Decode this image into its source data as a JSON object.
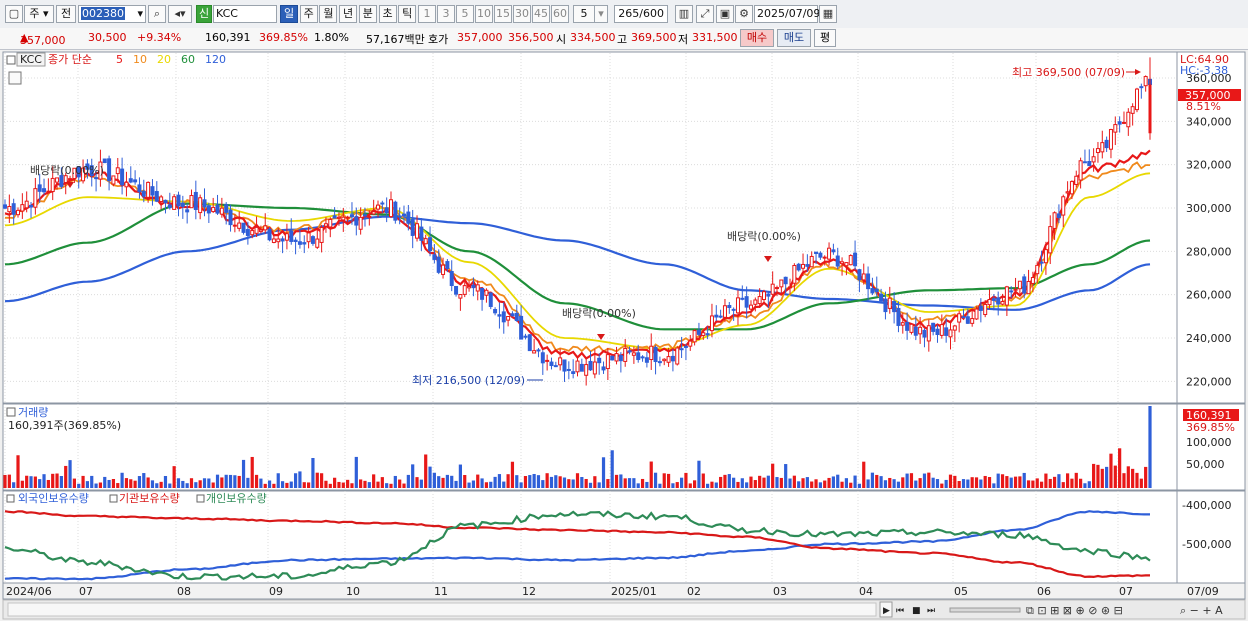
{
  "toolbar": {
    "market_label": "주",
    "prev_label": "전",
    "code": "002380",
    "new_badge": "신",
    "name": "KCC",
    "periods": [
      "일",
      "주",
      "월",
      "년",
      "분",
      "초",
      "틱"
    ],
    "minutes": [
      "1",
      "3",
      "5",
      "10",
      "15",
      "30",
      "45",
      "60"
    ],
    "tick_select": "5",
    "count": "265",
    "count_total": "/600",
    "date": "2025/07/09"
  },
  "quote": {
    "price": "357,000",
    "change": "30,500",
    "change_pct": "+9.34%",
    "volume": "160,391",
    "vol_pct": "369.85%",
    "turnover_pct": "1.80%",
    "amount": "57,167백만",
    "ask_label": "호가",
    "ask": "357,000",
    "bid": "356,500",
    "open_label": "시",
    "open": "334,500",
    "high_label": "고",
    "high": "369,500",
    "low_label": "저",
    "low": "331,500",
    "buy_label": "매수",
    "sell_label": "매도",
    "eval_label": "평"
  },
  "legend": {
    "symbol": "KCC",
    "ma_title": "종가 단순",
    "ma": [
      {
        "period": "5",
        "color": "#e81818"
      },
      {
        "period": "10",
        "color": "#f08a1c"
      },
      {
        "period": "20",
        "color": "#e8d800"
      },
      {
        "period": "60",
        "color": "#1f8f3a"
      },
      {
        "period": "120",
        "color": "#2f5fd8"
      }
    ]
  },
  "price_panel": {
    "lc": "LC:64.90",
    "hc": "HC:-3.38",
    "last_price": "357,000",
    "last_pct": "8.51%",
    "y_ticks": [
      "360,000",
      "340,000",
      "320,000",
      "300,000",
      "280,000",
      "260,000",
      "240,000",
      "220,000"
    ],
    "max_label": "최고 369,500 (07/09)",
    "min_label": "최저 216,500 (12/09)",
    "dividend_labels": [
      "배당락(0.00%)",
      "배당락(0.00%)",
      "배당락(0.00%)"
    ]
  },
  "volume_panel": {
    "title": "거래량",
    "value_label": "160,391주(369.85%)",
    "last": "160,391",
    "last_pct": "369.85%",
    "y_ticks": [
      "100,000",
      "50,000"
    ]
  },
  "holdings_panel": {
    "legend": [
      "외국인보유수량",
      "기관보유수량",
      "개인보유수량"
    ],
    "y_ticks": [
      "-400,000",
      "-500,000"
    ]
  },
  "x_axis": [
    "2024/06",
    "07",
    "08",
    "09",
    "10",
    "11",
    "12",
    "2025/01",
    "02",
    "03",
    "04",
    "05",
    "06",
    "07",
    "07/09"
  ],
  "colors": {
    "up": "#e81818",
    "down": "#2f5fd8",
    "foreign": "#2f5fd8",
    "institution": "#d81818",
    "individual": "#2e8b57"
  },
  "chart_data": {
    "type": "candlestick",
    "title": "KCC",
    "x": [
      "2024/06",
      "07",
      "08",
      "09",
      "10",
      "11",
      "12",
      "2025/01",
      "02",
      "03",
      "04",
      "05",
      "06",
      "07"
    ],
    "series": [
      {
        "name": "종가",
        "values": [
          300000,
          318000,
          302000,
          285000,
          300000,
          262000,
          228000,
          233000,
          255000,
          278000,
          242000,
          262000,
          322000,
          357000
        ]
      },
      {
        "name": "5",
        "values": [
          298000,
          316000,
          300000,
          288000,
          298000,
          265000,
          232000,
          234000,
          252000,
          276000,
          245000,
          260000,
          318000,
          325000
        ]
      },
      {
        "name": "10",
        "values": [
          296000,
          314000,
          302000,
          290000,
          300000,
          268000,
          235000,
          236000,
          250000,
          274000,
          248000,
          258000,
          314000,
          320000
        ]
      },
      {
        "name": "20",
        "values": [
          292000,
          305000,
          303000,
          294000,
          300000,
          275000,
          240000,
          235000,
          246000,
          272000,
          252000,
          255000,
          305000,
          316000
        ]
      },
      {
        "name": "60",
        "values": [
          274000,
          284000,
          302000,
          300000,
          297000,
          280000,
          256000,
          244000,
          244000,
          256000,
          262000,
          263000,
          274000,
          285000
        ]
      },
      {
        "name": "120",
        "values": [
          257000,
          266000,
          280000,
          290000,
          296000,
          293000,
          285000,
          274000,
          262000,
          258000,
          255000,
          253000,
          262000,
          274000
        ]
      }
    ],
    "ylim": [
      210000,
      372000
    ],
    "max": {
      "value": 369500,
      "date": "07/09"
    },
    "min": {
      "value": 216500,
      "date": "12/09"
    },
    "volume": {
      "last": 160391,
      "ylim": [
        0,
        160000
      ]
    },
    "holdings": {
      "ylim": [
        -570000,
        -380000
      ]
    }
  }
}
